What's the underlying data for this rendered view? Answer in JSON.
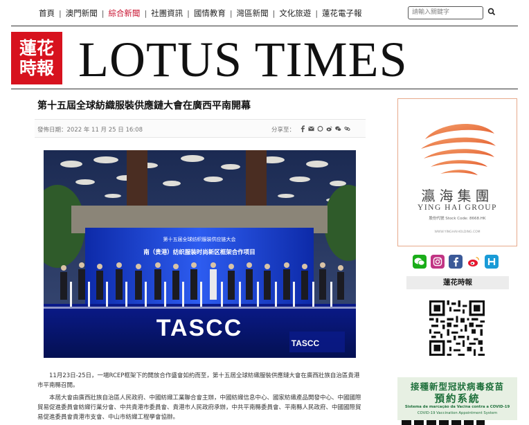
{
  "nav": {
    "items": [
      {
        "label": "首頁",
        "active": false
      },
      {
        "label": "澳門新聞",
        "active": false
      },
      {
        "label": "綜合新聞",
        "active": true
      },
      {
        "label": "社團資訊",
        "active": false
      },
      {
        "label": "國情教育",
        "active": false
      },
      {
        "label": "灣區新聞",
        "active": false
      },
      {
        "label": "文化旅遊",
        "active": false
      },
      {
        "label": "蓮花電子報",
        "active": false
      }
    ],
    "search_placeholder": "請輸入關鍵字"
  },
  "masthead": {
    "logo_line1": "蓮花",
    "logo_line2": "時報",
    "title": "LOTUS TIMES"
  },
  "article": {
    "title": "第十五屆全球紡織服裝供應鏈大會在廣西平南開幕",
    "publish_date": "發佈日期：2022 年 11 月 25 日 16:08",
    "share_label": "分享至：",
    "photo_text": {
      "brand": "TASCC",
      "brand_small": "TASCC",
      "banner_title": "第十五届全球纺织服装供应链大会",
      "banner_subtitle": "南（贵港）纺织服装时尚新区框架合作项目"
    },
    "paragraphs": [
      "11月23日-25日，一場RCEP框架下的開放合作盛會如約而至，第十五屆全球紡織服裝供應鏈大會在廣西壯族自治區貴港市平南縣召開。",
      "本屆大會由廣西壯族自治區人民政府、中國紡織工業聯合會主辦，中國紡織信息中心、國家紡織產品開發中心、中國國際貿易促進委員會紡織行業分會、中共貴港市委員會、貴港市人民政府承辦，中共平南縣委員會、平南縣人民政府、中國國際貿易促進委員會貴港市支會、中山市紡織工程學會協辦。"
    ]
  },
  "sidebar": {
    "ad": {
      "name_cn": "瀛海集團",
      "name_en": "YING HAI GROUP",
      "stock": "股份代號 Stock Code: 8668.HK",
      "website": "WWW.YINGHAIHOLDING.COM"
    },
    "social": [
      {
        "icon": "wechat-icon",
        "glyph": "◐",
        "color": "#1aad19"
      },
      {
        "icon": "instagram-icon",
        "glyph": "◎",
        "color": "#c13584"
      },
      {
        "icon": "facebook-icon",
        "glyph": "f",
        "color": "#3b5998"
      },
      {
        "icon": "weibo-icon",
        "glyph": "◉",
        "color": "#e6162d"
      },
      {
        "icon": "app-icon",
        "glyph": "H",
        "color": "#1a9bd7"
      }
    ],
    "label": "蓮花時報",
    "vaccine": {
      "line1": "接種新型冠狀病毒疫苗",
      "line2": "預約系統",
      "line3": "Sistema de marcação da Vacina contra a COVID-19",
      "line4": "COVID-19 Vaccination Appointment System"
    }
  }
}
